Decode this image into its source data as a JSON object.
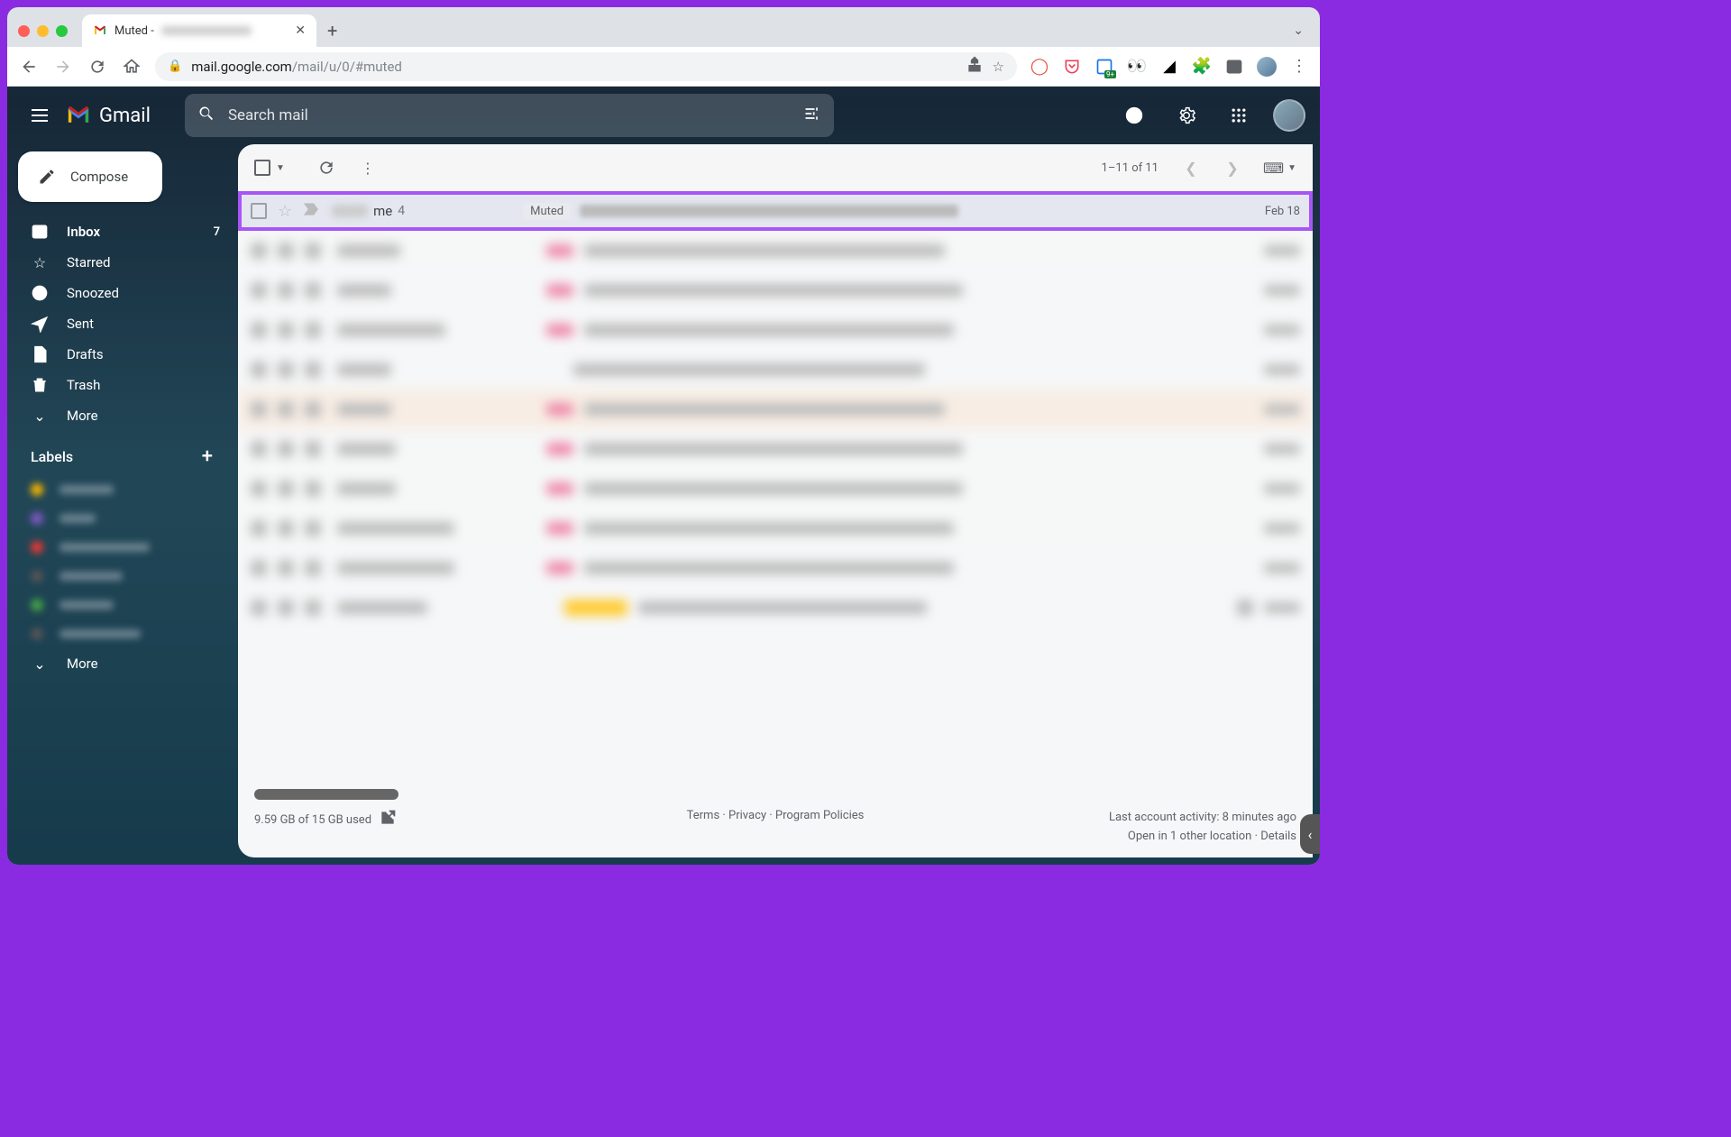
{
  "browser": {
    "tab_title": "Muted -",
    "url_host": "mail.google.com",
    "url_path": "/mail/u/0/#muted"
  },
  "header": {
    "logo_text": "Gmail",
    "search_placeholder": "Search mail"
  },
  "compose": {
    "label": "Compose"
  },
  "nav": {
    "inbox": {
      "label": "Inbox",
      "count": "7"
    },
    "starred": {
      "label": "Starred"
    },
    "snoozed": {
      "label": "Snoozed"
    },
    "sent": {
      "label": "Sent"
    },
    "drafts": {
      "label": "Drafts"
    },
    "trash": {
      "label": "Trash"
    },
    "more": {
      "label": "More"
    }
  },
  "labels": {
    "header": "Labels",
    "more": "More"
  },
  "toolbar": {
    "page_info": "1–11 of 11"
  },
  "mail": {
    "row0": {
      "sender": "me",
      "thread_count": "4",
      "muted_badge": "Muted",
      "date": "Feb 18"
    }
  },
  "footer": {
    "storage": "9.59 GB of 15 GB used",
    "terms": "Terms",
    "privacy": "Privacy",
    "policies": "Program Policies",
    "sep": " · ",
    "activity_line": "Last account activity: 8 minutes ago",
    "location_line": "Open in 1 other location",
    "details": "Details"
  }
}
